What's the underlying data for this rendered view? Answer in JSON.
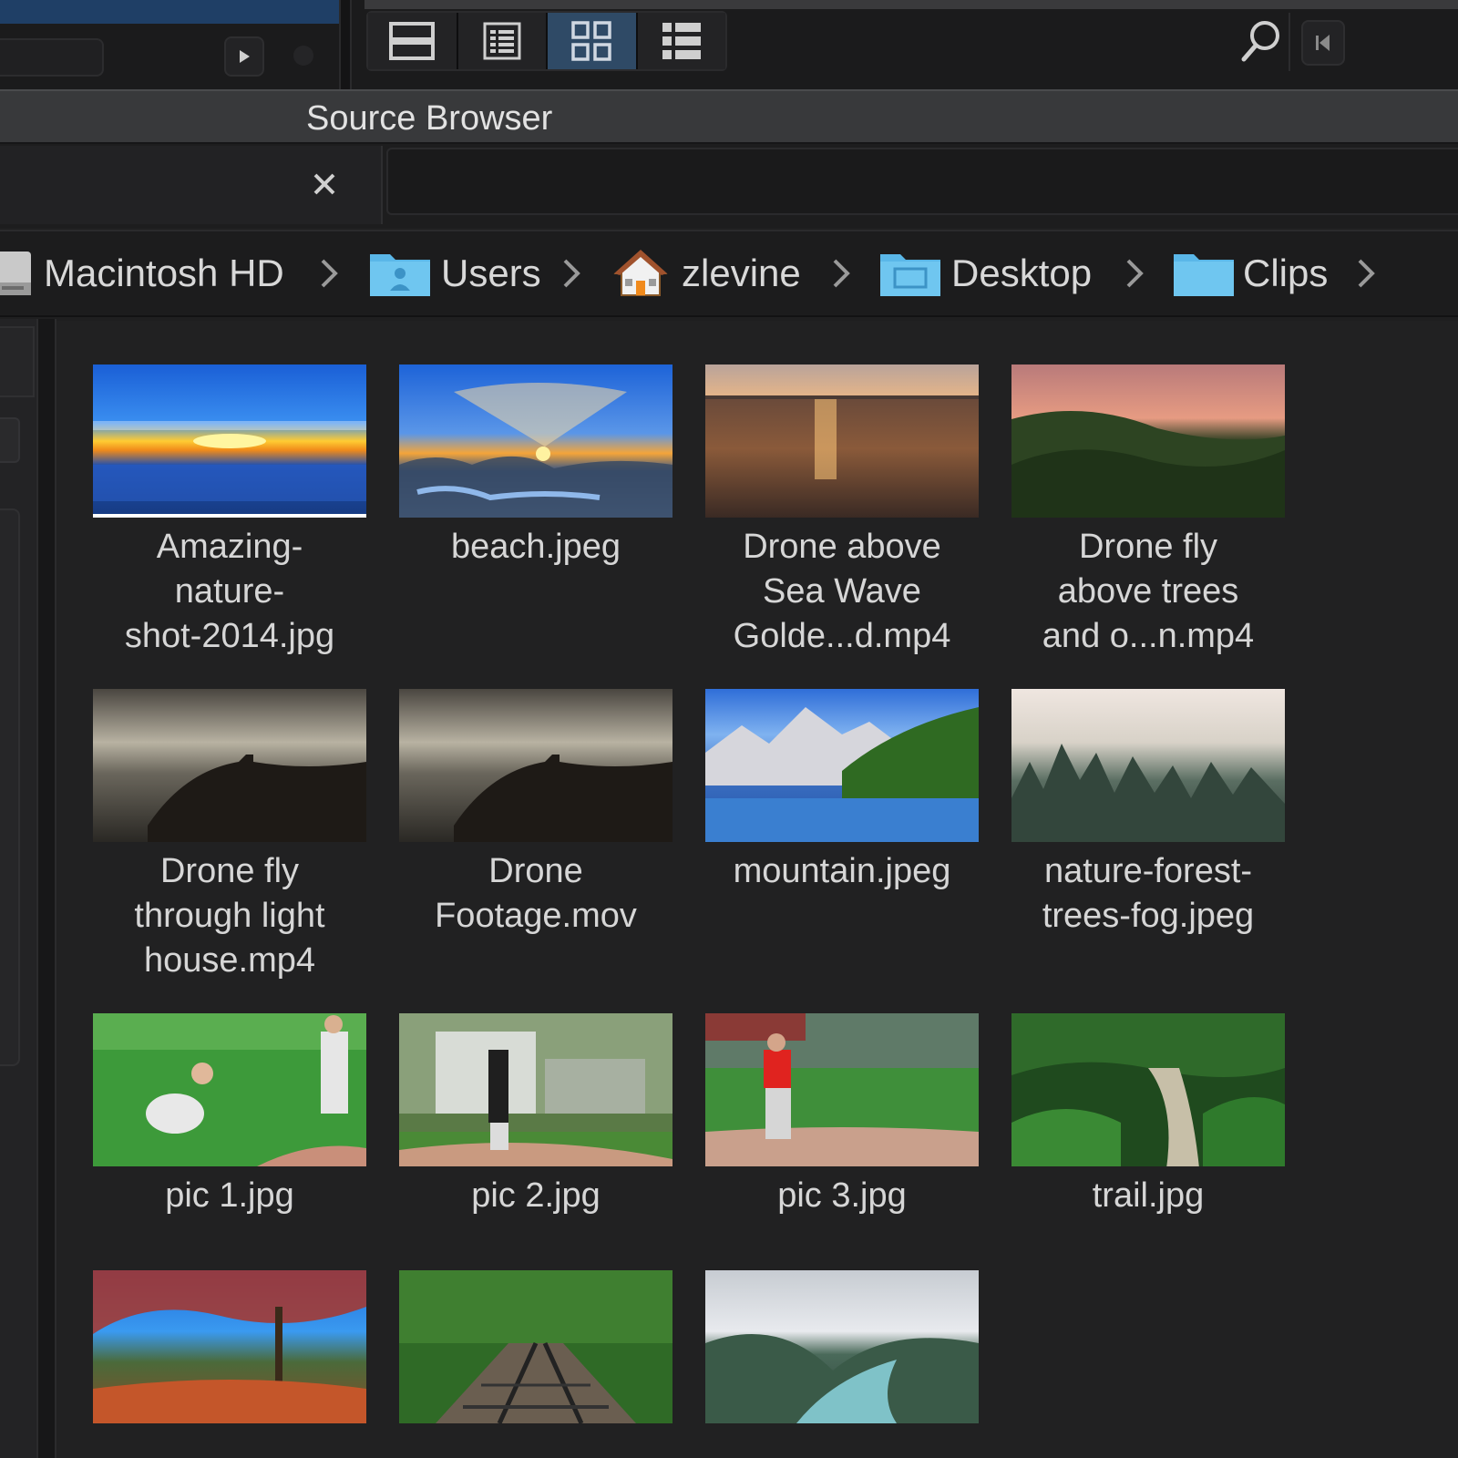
{
  "toolbar": {
    "views": [
      {
        "name": "filmstrip-view",
        "active": false
      },
      {
        "name": "list-view",
        "active": false
      },
      {
        "name": "grid-view",
        "active": true
      },
      {
        "name": "detail-list-view",
        "active": false
      }
    ],
    "search_icon": "magnifier-icon",
    "collapse_icon": "triangle-left-icon"
  },
  "panel": {
    "title": "Source Browser"
  },
  "search": {
    "value": ""
  },
  "breadcrumb": [
    {
      "label": "Macintosh HD",
      "icon": "hard-drive-icon"
    },
    {
      "label": "Users",
      "icon": "users-folder-icon"
    },
    {
      "label": "zlevine",
      "icon": "home-icon"
    },
    {
      "label": "Desktop",
      "icon": "desktop-folder-icon"
    },
    {
      "label": "Clips",
      "icon": "folder-icon"
    }
  ],
  "files": [
    {
      "name": "Amazing-\nnature-\nshot-2014.jpg"
    },
    {
      "name": "beach.jpeg"
    },
    {
      "name": "Drone above\nSea Wave\nGolde...d.mp4"
    },
    {
      "name": "Drone fly\nabove trees\nand o...n.mp4"
    },
    {
      "name": "Drone fly\nthrough light\nhouse.mp4"
    },
    {
      "name": "Drone\nFootage.mov"
    },
    {
      "name": "mountain.jpeg"
    },
    {
      "name": "nature-forest-\ntrees-fog.jpeg"
    },
    {
      "name": "pic 1.jpg"
    },
    {
      "name": "pic 2.jpg"
    },
    {
      "name": "pic 3.jpg"
    },
    {
      "name": "trail.jpg"
    },
    {
      "name": ""
    },
    {
      "name": ""
    },
    {
      "name": ""
    }
  ],
  "colors": {
    "accent": "#2f4a66",
    "folder": "#5ab7e8",
    "background": "#212122"
  }
}
